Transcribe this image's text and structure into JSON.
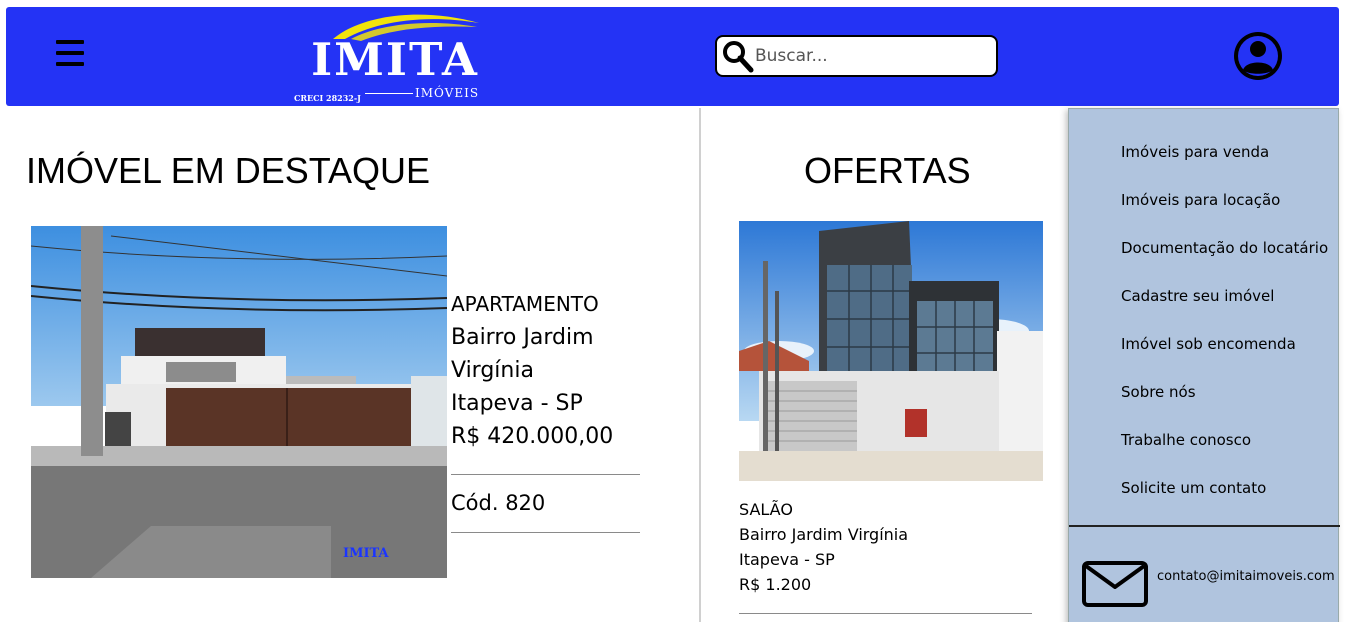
{
  "header": {
    "logo": {
      "brand": "IMITA",
      "subtitle": "IMÓVEIS",
      "creci": "CRECI 28232-J"
    },
    "search": {
      "placeholder": "Buscar..."
    },
    "colors": {
      "header_bg": "#2433f5",
      "menu_bg": "#b0c4de"
    },
    "icons": [
      "hamburger-menu-icon",
      "search-icon",
      "user-avatar-icon"
    ]
  },
  "featured": {
    "title": "IMÓVEL EM DESTAQUE",
    "watermark": "IMITA",
    "type": "APARTAMENTO",
    "neighborhood_1": "Bairro Jardim",
    "neighborhood_2": "Virgínia",
    "city": "Itapeva - SP",
    "price": "R$ 420.000,00",
    "code": "Cód. 820"
  },
  "offers": {
    "title": "OFERTAS",
    "items": [
      {
        "type": "SALÃO",
        "neighborhood": "Bairro Jardim Virgínia",
        "city": "Itapeva - SP",
        "price": "R$ 1.200"
      }
    ]
  },
  "menu": {
    "items": [
      {
        "label": "Imóveis para venda"
      },
      {
        "label": "Imóveis para locação"
      },
      {
        "label": "Documentação do locatário"
      },
      {
        "label": "Cadastre seu imóvel"
      },
      {
        "label": "Imóvel sob encomenda"
      },
      {
        "label": "Sobre nós"
      },
      {
        "label": "Trabalhe conosco"
      },
      {
        "label": "Solicite um contato"
      }
    ],
    "contact_email": "contato@imitaimoveis.com"
  }
}
